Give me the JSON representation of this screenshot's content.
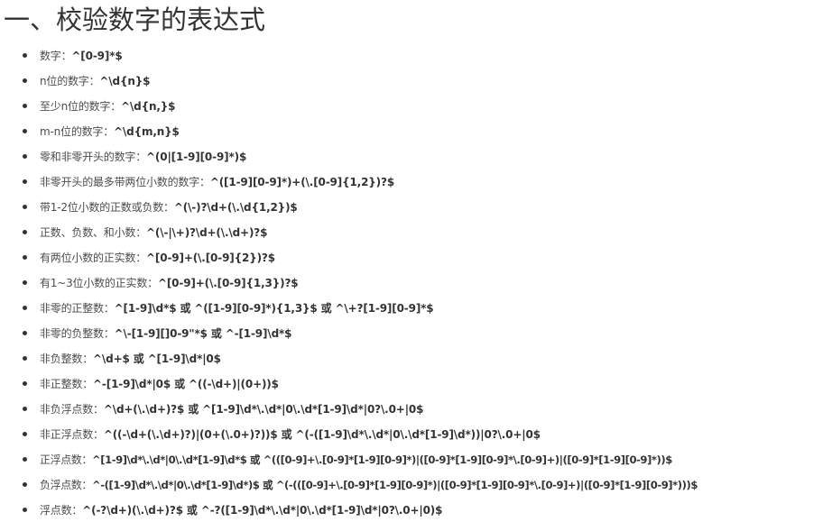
{
  "heading": "一、校验数字的表达式",
  "rules": [
    {
      "desc": "数字：",
      "pattern": "^[0-9]*$"
    },
    {
      "desc": "n位的数字：",
      "pattern": "^\\d{n}$"
    },
    {
      "desc": "至少n位的数字：",
      "pattern": "^\\d{n,}$"
    },
    {
      "desc": "m-n位的数字：",
      "pattern": "^\\d{m,n}$"
    },
    {
      "desc": "零和非零开头的数字：",
      "pattern": "^(0|[1-9][0-9]*)$"
    },
    {
      "desc": "非零开头的最多带两位小数的数字：",
      "pattern": "^([1-9][0-9]*)+(\\.[0-9]{1,2})?$"
    },
    {
      "desc": "带1-2位小数的正数或负数：",
      "pattern": "^(\\-)?\\d+(\\.\\d{1,2})$"
    },
    {
      "desc": "正数、负数、和小数：",
      "pattern": "^(\\-|\\+)?\\d+(\\.\\d+)?$"
    },
    {
      "desc": "有两位小数的正实数：",
      "pattern": "^[0-9]+(\\.[0-9]{2})?$"
    },
    {
      "desc": "有1~3位小数的正实数：",
      "pattern": "^[0-9]+(\\.[0-9]{1,3})?$"
    },
    {
      "desc": "非零的正整数：",
      "pattern": "^[1-9]\\d*$ 或 ^([1-9][0-9]*){1,3}$ 或 ^\\+?[1-9][0-9]*$"
    },
    {
      "desc": "非零的负整数：",
      "pattern": "^\\-[1-9][]0-9\"*$ 或 ^-[1-9]\\d*$"
    },
    {
      "desc": "非负整数：",
      "pattern": "^\\d+$ 或 ^[1-9]\\d*|0$"
    },
    {
      "desc": "非正整数：",
      "pattern": "^-[1-9]\\d*|0$ 或 ^((-\\d+)|(0+))$"
    },
    {
      "desc": "非负浮点数：",
      "pattern": "^\\d+(\\.\\d+)?$ 或 ^[1-9]\\d*\\.\\d*|0\\.\\d*[1-9]\\d*|0?\\.0+|0$"
    },
    {
      "desc": "非正浮点数：",
      "pattern": "^((-\\d+(\\.\\d+)?)|(0+(\\.0+)?))$ 或 ^(-([1-9]\\d*\\.\\d*|0\\.\\d*[1-9]\\d*))|0?\\.0+|0$"
    },
    {
      "desc": "正浮点数：",
      "pattern": "^[1-9]\\d*\\.\\d*|0\\.\\d*[1-9]\\d*$ 或 ^(([0-9]+\\.[0-9]*[1-9][0-9]*)|([0-9]*[1-9][0-9]*\\.[0-9]+)|([0-9]*[1-9][0-9]*))$"
    },
    {
      "desc": "负浮点数：",
      "pattern": "^-([1-9]\\d*\\.\\d*|0\\.\\d*[1-9]\\d*)$ 或 ^(-(([0-9]+\\.[0-9]*[1-9][0-9]*)|([0-9]*[1-9][0-9]*\\.[0-9]+)|([0-9]*[1-9][0-9]*)))$"
    },
    {
      "desc": "浮点数：",
      "pattern": "^(-?\\d+)(\\.\\d+)?$ 或 ^-?([1-9]\\d*\\.\\d*|0\\.\\d*[1-9]\\d*|0?\\.0+|0)$"
    }
  ]
}
